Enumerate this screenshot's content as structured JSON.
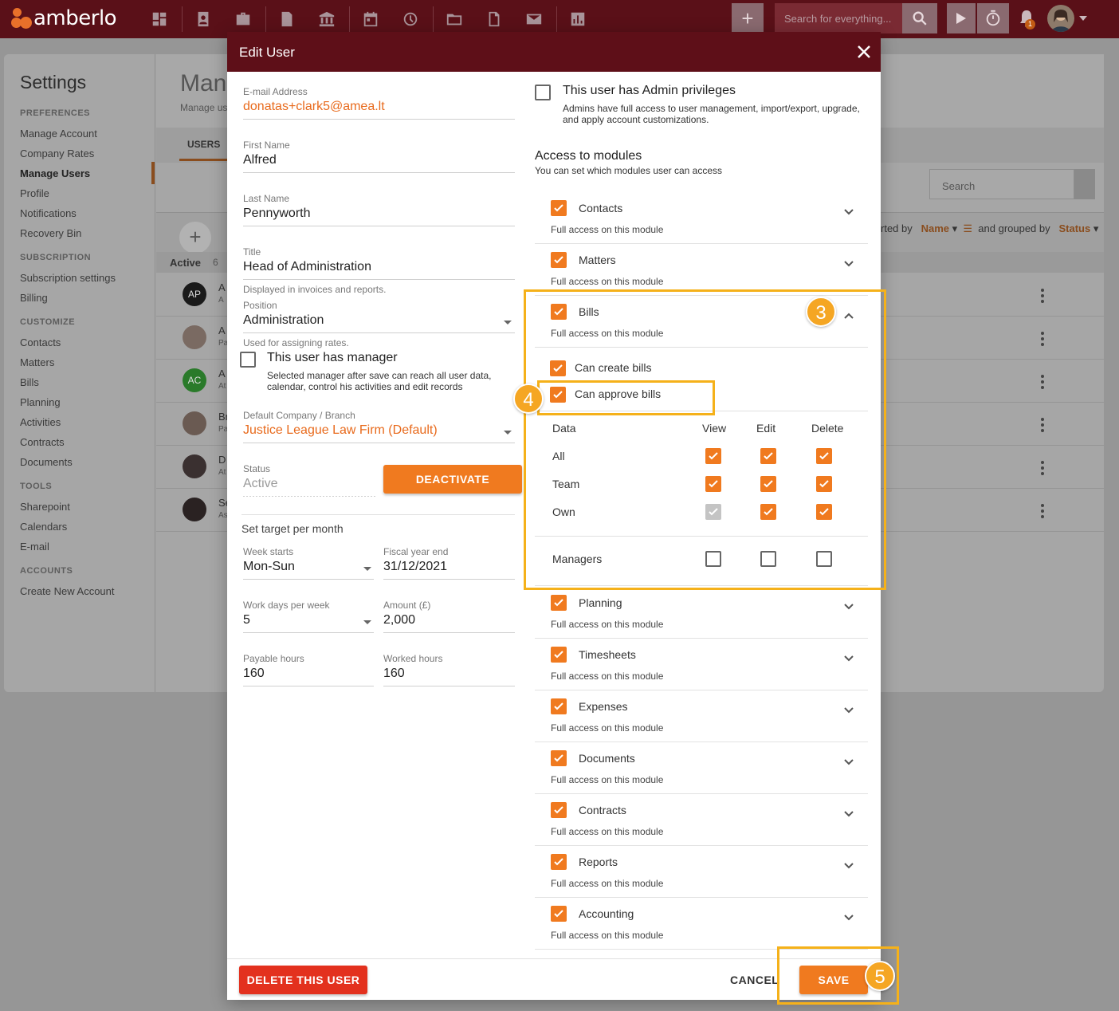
{
  "topbar": {
    "logo": "amberlo",
    "search_placeholder": "Search for everything...",
    "notification_count": "1",
    "icons": [
      "dashboard-icon",
      "contacts-icon",
      "matters-icon",
      "bills-icon",
      "bank-icon",
      "calendar-icon",
      "activities-icon",
      "folder-icon",
      "documents-icon",
      "email-icon",
      "reports-icon"
    ]
  },
  "background": {
    "sidebar": {
      "title": "Settings",
      "sections": [
        {
          "label": "PREFERENCES",
          "items": [
            "Manage Account",
            "Company Rates",
            "Manage Users",
            "Profile",
            "Notifications",
            "Recovery Bin"
          ]
        },
        {
          "label": "SUBSCRIPTION",
          "items": [
            "Subscription settings",
            "Billing"
          ]
        },
        {
          "label": "CUSTOMIZE",
          "items": [
            "Contacts",
            "Matters",
            "Bills",
            "Planning",
            "Activities",
            "Contracts",
            "Documents"
          ]
        },
        {
          "label": "TOOLS",
          "items": [
            "Sharepoint",
            "Calendars",
            "E-mail"
          ]
        },
        {
          "label": "ACCOUNTS",
          "items": [
            "Create New Account"
          ]
        }
      ]
    },
    "header_title": "Man",
    "header_sub": "Manage us",
    "tab": "USERS",
    "search_placeholder": "Search",
    "list_group": "Active",
    "list_count": "6",
    "sorted_by_label": "rted by",
    "sorted_by_value": "Name",
    "grouped_by_label": "and grouped by",
    "grouped_by_value": "Status",
    "rows": [
      {
        "initials": "AP",
        "line1": "A",
        "line2": "A"
      },
      {
        "initials": "",
        "line1": "A",
        "line2": "Pa"
      },
      {
        "initials": "AC",
        "line1": "A",
        "line2": "At"
      },
      {
        "initials": "",
        "line1": "Br",
        "line2": "Pa"
      },
      {
        "initials": "",
        "line1": "D",
        "line2": "At"
      },
      {
        "initials": "",
        "line1": "Se",
        "line2": "As"
      }
    ]
  },
  "modal": {
    "title": "Edit User",
    "email": {
      "label": "E-mail Address",
      "value": "donatas+clark5@amea.lt"
    },
    "first_name": {
      "label": "First Name",
      "value": "Alfred"
    },
    "last_name": {
      "label": "Last Name",
      "value": "Pennyworth"
    },
    "title_field": {
      "label": "Title",
      "value": "Head of Administration",
      "hint": "Displayed in invoices and reports."
    },
    "position": {
      "label": "Position",
      "value": "Administration",
      "hint": "Used for assigning rates."
    },
    "manager": {
      "label": "This user has manager",
      "desc": "Selected manager after save can reach all user data, calendar, control his activities and edit records",
      "checked": false
    },
    "company": {
      "label": "Default Company / Branch",
      "value": "Justice League Law Firm (Default)"
    },
    "status": {
      "label": "Status",
      "value": "Active"
    },
    "deactivate_label": "DEACTIVATE",
    "target_title": "Set target per month",
    "week_starts": {
      "label": "Week starts",
      "value": "Mon-Sun"
    },
    "fiscal_year_end": {
      "label": "Fiscal year end",
      "value": "31/12/2021"
    },
    "work_days": {
      "label": "Work days per week",
      "value": "5"
    },
    "amount": {
      "label": "Amount (£)",
      "value": "2,000"
    },
    "payable_hours": {
      "label": "Payable hours",
      "value": "160"
    },
    "worked_hours": {
      "label": "Worked hours",
      "value": "160"
    },
    "admin": {
      "label": "This user has Admin privileges",
      "desc": "Admins have full access to user management, import/export, upgrade, and apply account customizations.",
      "checked": false
    },
    "modules_title": "Access to modules",
    "modules_sub": "You can set which modules user can access",
    "modules": [
      {
        "name": "Contacts",
        "desc": "Full access on this module"
      },
      {
        "name": "Matters",
        "desc": "Full access on this module"
      },
      {
        "name": "Bills",
        "desc": "Full access on this module"
      },
      {
        "name": "Planning",
        "desc": "Full access on this module"
      },
      {
        "name": "Timesheets",
        "desc": "Full access on this module"
      },
      {
        "name": "Expenses",
        "desc": "Full access on this module"
      },
      {
        "name": "Documents",
        "desc": "Full access on this module"
      },
      {
        "name": "Contracts",
        "desc": "Full access on this module"
      },
      {
        "name": "Reports",
        "desc": "Full access on this module"
      },
      {
        "name": "Accounting",
        "desc": "Full access on this module"
      }
    ],
    "bills_perms": {
      "create": "Can create bills",
      "approve": "Can approve bills",
      "headers": [
        "Data",
        "View",
        "Edit",
        "Delete"
      ],
      "rows": [
        "All",
        "Team",
        "Own"
      ],
      "managers": "Managers"
    },
    "delete_label": "DELETE THIS USER",
    "cancel_label": "CANCEL",
    "save_label": "SAVE"
  },
  "steps": [
    "3",
    "4",
    "5"
  ],
  "colors": {
    "brand": "#5e0f18",
    "accent": "#f07a1f",
    "danger": "#e3311e",
    "highlight": "#f5b11a"
  }
}
